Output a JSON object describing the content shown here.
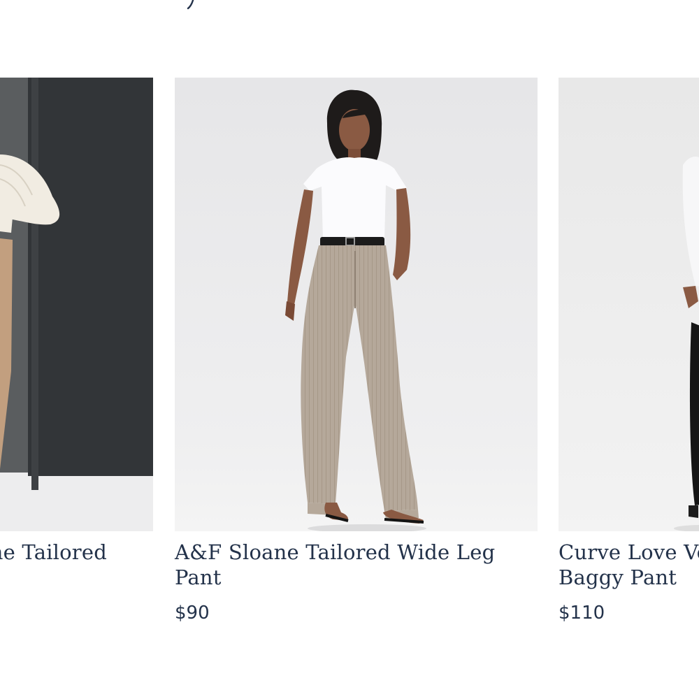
{
  "products": [
    {
      "name": "A&F Sloane Tailored Wide Leg Pant",
      "visible_name": "ne Tailored",
      "price": "",
      "image_alt": "Model in cream cable-knit sweater and camel wide leg pants"
    },
    {
      "name": "A&F Sloane Tailored Wide Leg Pant",
      "price": "$90",
      "image_alt": "Model in white tee and taupe pinstripe tailored wide leg pants"
    },
    {
      "name": "Curve Love Vegan Leather Baggy Pant",
      "visible_name": "Curve Love Ve\nBaggy Pant",
      "price": "$110",
      "image_alt": "Model in white long sleeve top and black baggy pants"
    }
  ],
  "colors": {
    "text": "#23324a",
    "background": "#ffffff"
  }
}
